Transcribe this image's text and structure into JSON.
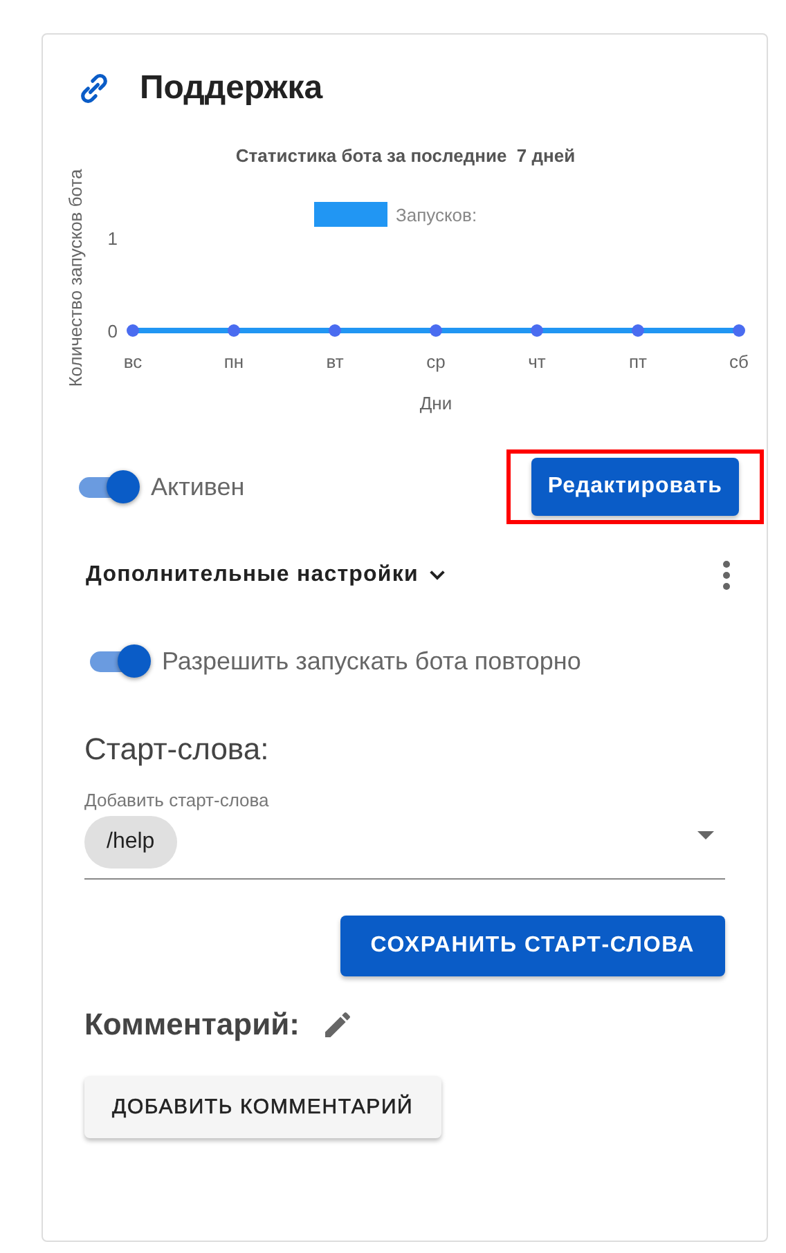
{
  "card": {
    "title": "Поддержка"
  },
  "chart": {
    "chart_data": {
      "type": "line",
      "title": "Статистика бота за последние  7 дней",
      "xlabel": "Дни",
      "ylabel": "Количество запусков бота",
      "categories": [
        "вс",
        "пн",
        "вт",
        "ср",
        "чт",
        "пт",
        "сб"
      ],
      "series": [
        {
          "name": "Запусков:",
          "color": "#2196f3",
          "values": [
            0,
            0,
            0,
            0,
            0,
            0,
            0
          ],
          "marker": "circle"
        }
      ],
      "ylim": [
        0,
        1
      ],
      "yticks": [
        0,
        1
      ]
    }
  },
  "active_toggle": {
    "label": "Активен",
    "on": true
  },
  "edit_button": {
    "label": "Редактировать",
    "highlighted": true
  },
  "advanced_settings": {
    "label": "Дополнительные настройки",
    "expanded": true
  },
  "repeat_toggle": {
    "label": "Разрешить запускать бота повторно",
    "on": true
  },
  "start_words": {
    "heading": "Старт-слова:",
    "field_label": "Добавить старт-слова",
    "chips": [
      "/help"
    ],
    "save_button": "СОХРАНИТЬ СТАРТ-СЛОВА"
  },
  "comment": {
    "heading": "Комментарий:",
    "add_button": "ДОБАВИТЬ КОММЕНТАРИЙ"
  }
}
